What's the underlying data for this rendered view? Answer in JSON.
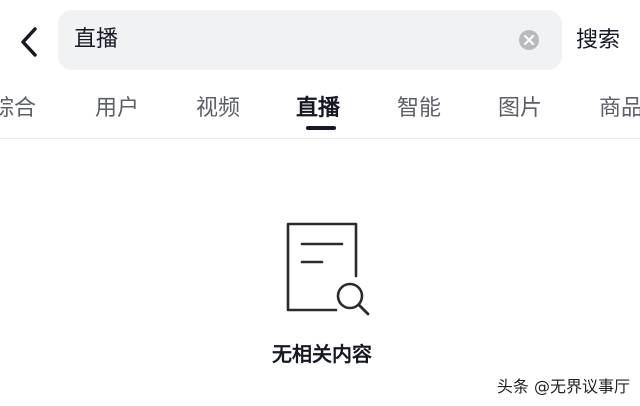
{
  "search": {
    "value": "直播",
    "button_label": "搜索"
  },
  "tabs": [
    {
      "label": "综合",
      "active": false
    },
    {
      "label": "用户",
      "active": false
    },
    {
      "label": "视频",
      "active": false
    },
    {
      "label": "直播",
      "active": true
    },
    {
      "label": "智能",
      "active": false
    },
    {
      "label": "图片",
      "active": false
    },
    {
      "label": "商品",
      "active": false
    }
  ],
  "empty_state": {
    "icon": "document-search-icon",
    "message": "无相关内容"
  },
  "watermark": {
    "text": "头条 @无界议事厅"
  },
  "icons": {
    "back": "chevron-left-icon",
    "clear": "clear-icon"
  },
  "colors": {
    "search_bg": "#f1f2f4",
    "text_primary": "#161823",
    "text_secondary": "#5d5f66"
  }
}
